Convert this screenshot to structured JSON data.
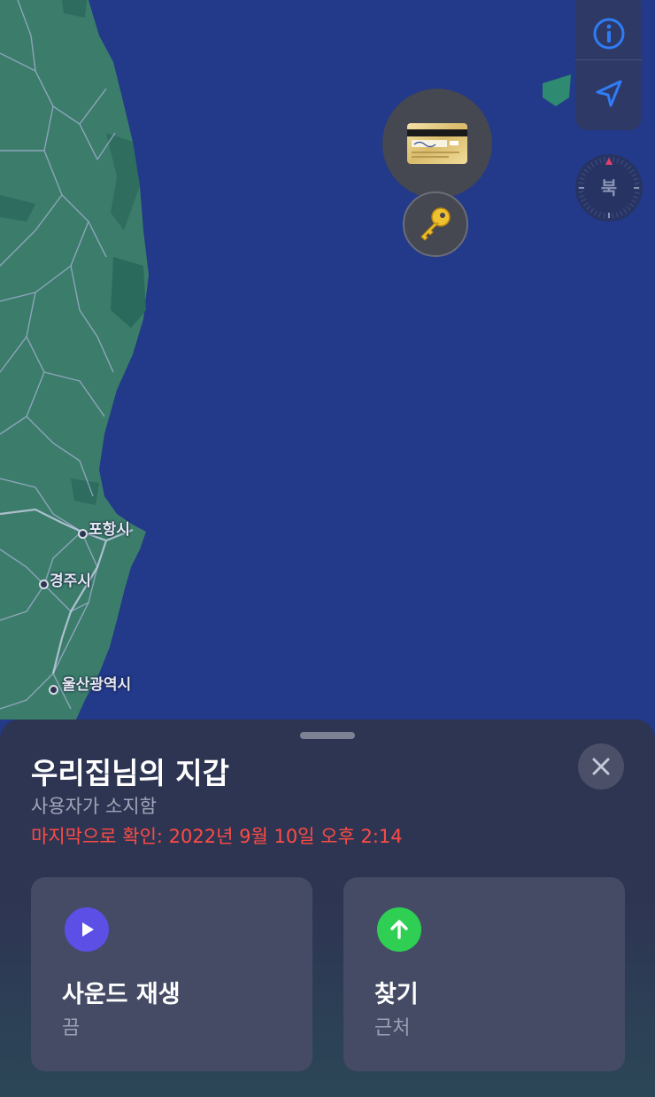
{
  "map": {
    "cities": [
      {
        "name": "포항시"
      },
      {
        "name": "경주시"
      },
      {
        "name": "울산광역시"
      }
    ],
    "controls": {
      "info_icon": "info-circle-icon",
      "location_icon": "location-arrow-icon",
      "compass_label": "북"
    },
    "pins": [
      {
        "type": "card",
        "icon": "credit-card-icon"
      },
      {
        "type": "key",
        "icon": "key-icon"
      }
    ],
    "colors": {
      "sea": "#23398a",
      "land": "#3b7d6a",
      "accent": "#2f7cf6"
    }
  },
  "sheet": {
    "title": "우리집님의 지갑",
    "owner": "사용자가 소지함",
    "last_seen": "마지막으로 확인: 2022년 9월 10일 오후 2:14",
    "close_icon": "close-icon",
    "actions": [
      {
        "title": "사운드 재생",
        "subtitle": "끔",
        "icon": "play-icon",
        "color": "#5b4fe6"
      },
      {
        "title": "찾기",
        "subtitle": "근처",
        "icon": "arrow-up-icon",
        "color": "#2fcf54"
      }
    ]
  }
}
